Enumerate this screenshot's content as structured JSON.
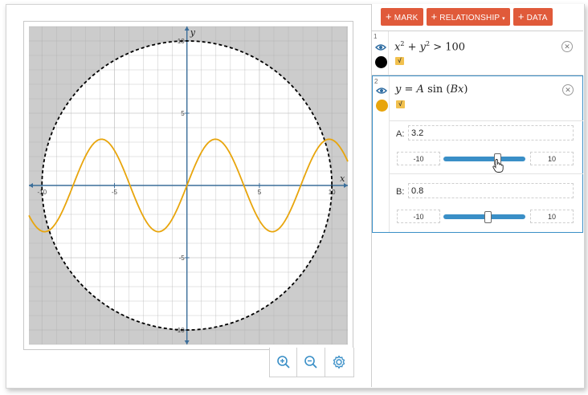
{
  "toolbar": {
    "mark_label": "MARK",
    "relationship_label": "RELATIONSHIP",
    "data_label": "DATA",
    "accent_color": "#e05a3a"
  },
  "expressions": [
    {
      "index": "1",
      "formula": "x² + y² > 100",
      "color": "#000000",
      "visible": true
    },
    {
      "index": "2",
      "formula": "y = A sin (Bx)",
      "color": "#e8a50c",
      "visible": true,
      "params": [
        {
          "name": "A:",
          "value": "3.2",
          "min": "-10",
          "max": "10",
          "position": 0.66
        },
        {
          "name": "B:",
          "value": "0.8",
          "min": "-10",
          "max": "10",
          "position": 0.54
        }
      ]
    }
  ],
  "graph": {
    "x_label": "x",
    "y_label": "y",
    "x_ticks": [
      "-10",
      "-5",
      "5",
      "10"
    ],
    "y_ticks": [
      "10",
      "5",
      "-5",
      "-10"
    ],
    "x_range": [
      -10.9,
      11.1
    ],
    "y_range": [
      -11.0,
      11.0
    ],
    "curve_color": "#e8a50c",
    "region_color": "#cccccc",
    "axis_color": "#3b6e9a"
  },
  "zoom": {
    "zoom_in_icon": "zoom-in-icon",
    "zoom_out_icon": "zoom-out-icon",
    "settings_icon": "gear-icon"
  }
}
